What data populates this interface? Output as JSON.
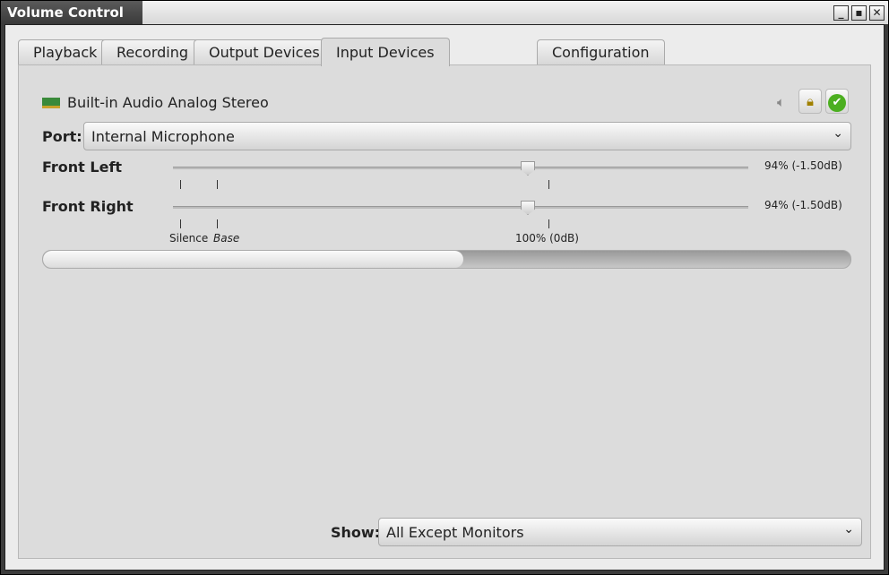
{
  "window": {
    "title": "Volume Control",
    "controls": [
      "minimize",
      "maximize",
      "close"
    ]
  },
  "tabs": [
    {
      "label": "Playback"
    },
    {
      "label": "Recording"
    },
    {
      "label": "Output Devices"
    },
    {
      "label": "Input Devices",
      "active": true
    },
    {
      "label": "Configuration"
    }
  ],
  "device": {
    "name": "Built-in Audio Analog Stereo",
    "icon": "sound-card-icon",
    "port_label": "Port:",
    "port_value": "Internal Microphone",
    "channels": [
      {
        "label": "Front Left",
        "percent": 94,
        "value": "94% (-1.50dB)"
      },
      {
        "label": "Front Right",
        "percent": 94,
        "value": "94% (-1.50dB)"
      }
    ],
    "marks": {
      "silence": "Silence",
      "base": "Base",
      "full": "100% (0dB)"
    },
    "peak_level": 0.52,
    "muted": false,
    "locked": true,
    "default": true
  },
  "footer": {
    "show_label": "Show:",
    "show_value": "All Except Monitors"
  },
  "colors": {
    "accent_green": "#4caf20",
    "titlebar": "#4a4a4a"
  }
}
